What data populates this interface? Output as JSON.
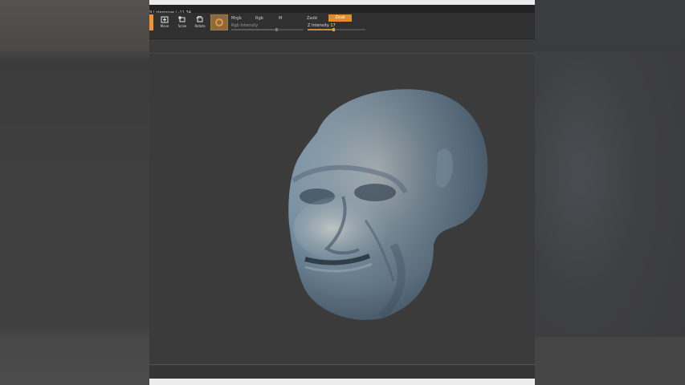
{
  "window": {
    "title": "9 | ztemnow | -11.34"
  },
  "toolbar": {
    "tools": [
      {
        "label": "Move"
      },
      {
        "label": "Scale"
      },
      {
        "label": "Rotate"
      }
    ],
    "modes": {
      "mrgb": "Mrgb",
      "rgb": "Rgb",
      "m": "M",
      "zadd": "Zadd",
      "zsub": "Zsub"
    },
    "sliders": {
      "rgb_intensity": {
        "label": "Rgb Intensity",
        "value": 0.62
      },
      "z_intensity": {
        "label": "Z Intensity 17",
        "value": 0.45
      }
    }
  },
  "viewport": {
    "subject": "sculpted-head",
    "background": "#3b3b3b",
    "model_color": "#8fa3b3"
  },
  "colors": {
    "accent": "#f0952a",
    "titlebar": "#ececec",
    "toolbar": "#303030"
  }
}
